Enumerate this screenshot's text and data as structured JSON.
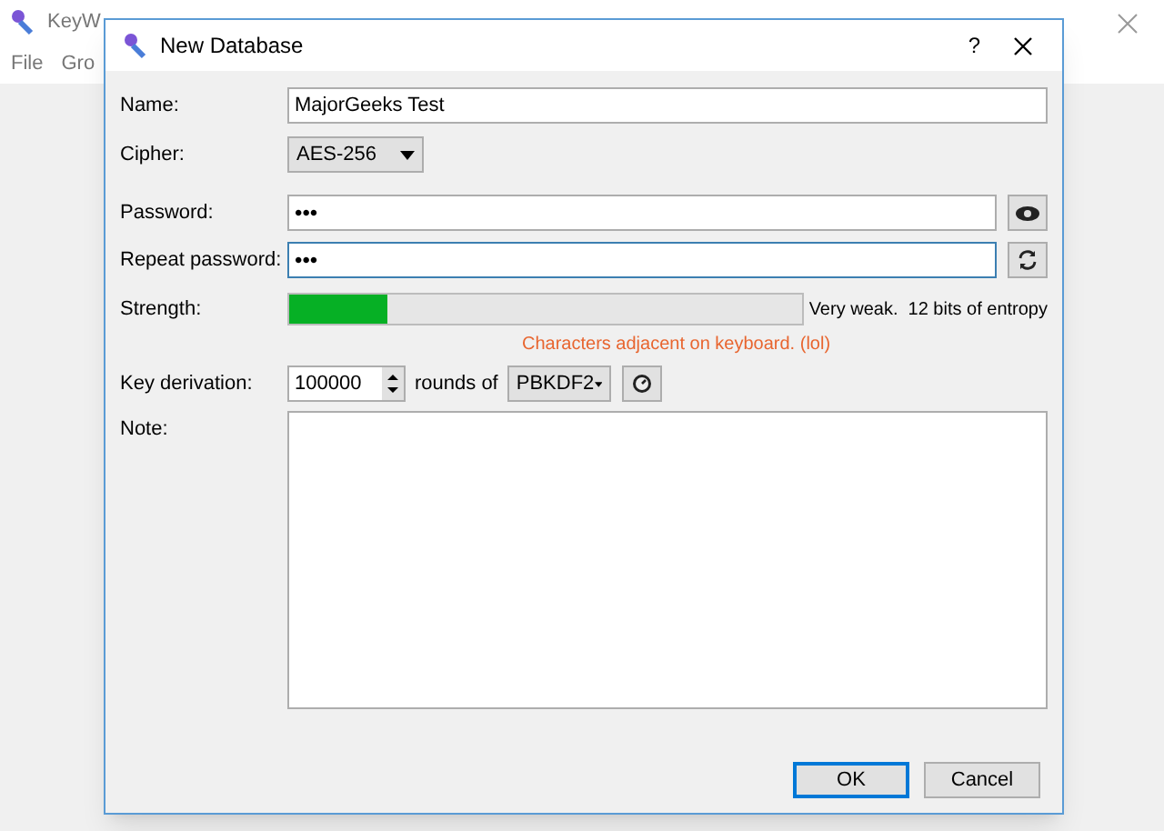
{
  "background_window": {
    "title": "KeyW",
    "menu": [
      "File",
      "Gro"
    ]
  },
  "dialog": {
    "title": "New Database",
    "help": "?",
    "name": {
      "label": "Name:",
      "value": "MajorGeeks Test"
    },
    "cipher": {
      "label": "Cipher:",
      "value": "AES-256"
    },
    "password": {
      "label": "Password:",
      "value": "•••"
    },
    "repeat_password": {
      "label": "Repeat password:",
      "value": "•••",
      "focused": true
    },
    "strength": {
      "label": "Strength:",
      "level": 0.19,
      "reading": "Very weak.  12 bits of entropy",
      "warning": "Characters adjacent on keyboard. (lol)"
    },
    "key_derivation": {
      "label": "Key derivation:",
      "rounds": "100000",
      "rounds_of": "rounds of",
      "algorithm": "PBKDF2"
    },
    "note": {
      "label": "Note:"
    },
    "buttons": [
      {
        "label": "OK",
        "default": true
      },
      {
        "label": "Cancel",
        "default": false
      }
    ]
  }
}
